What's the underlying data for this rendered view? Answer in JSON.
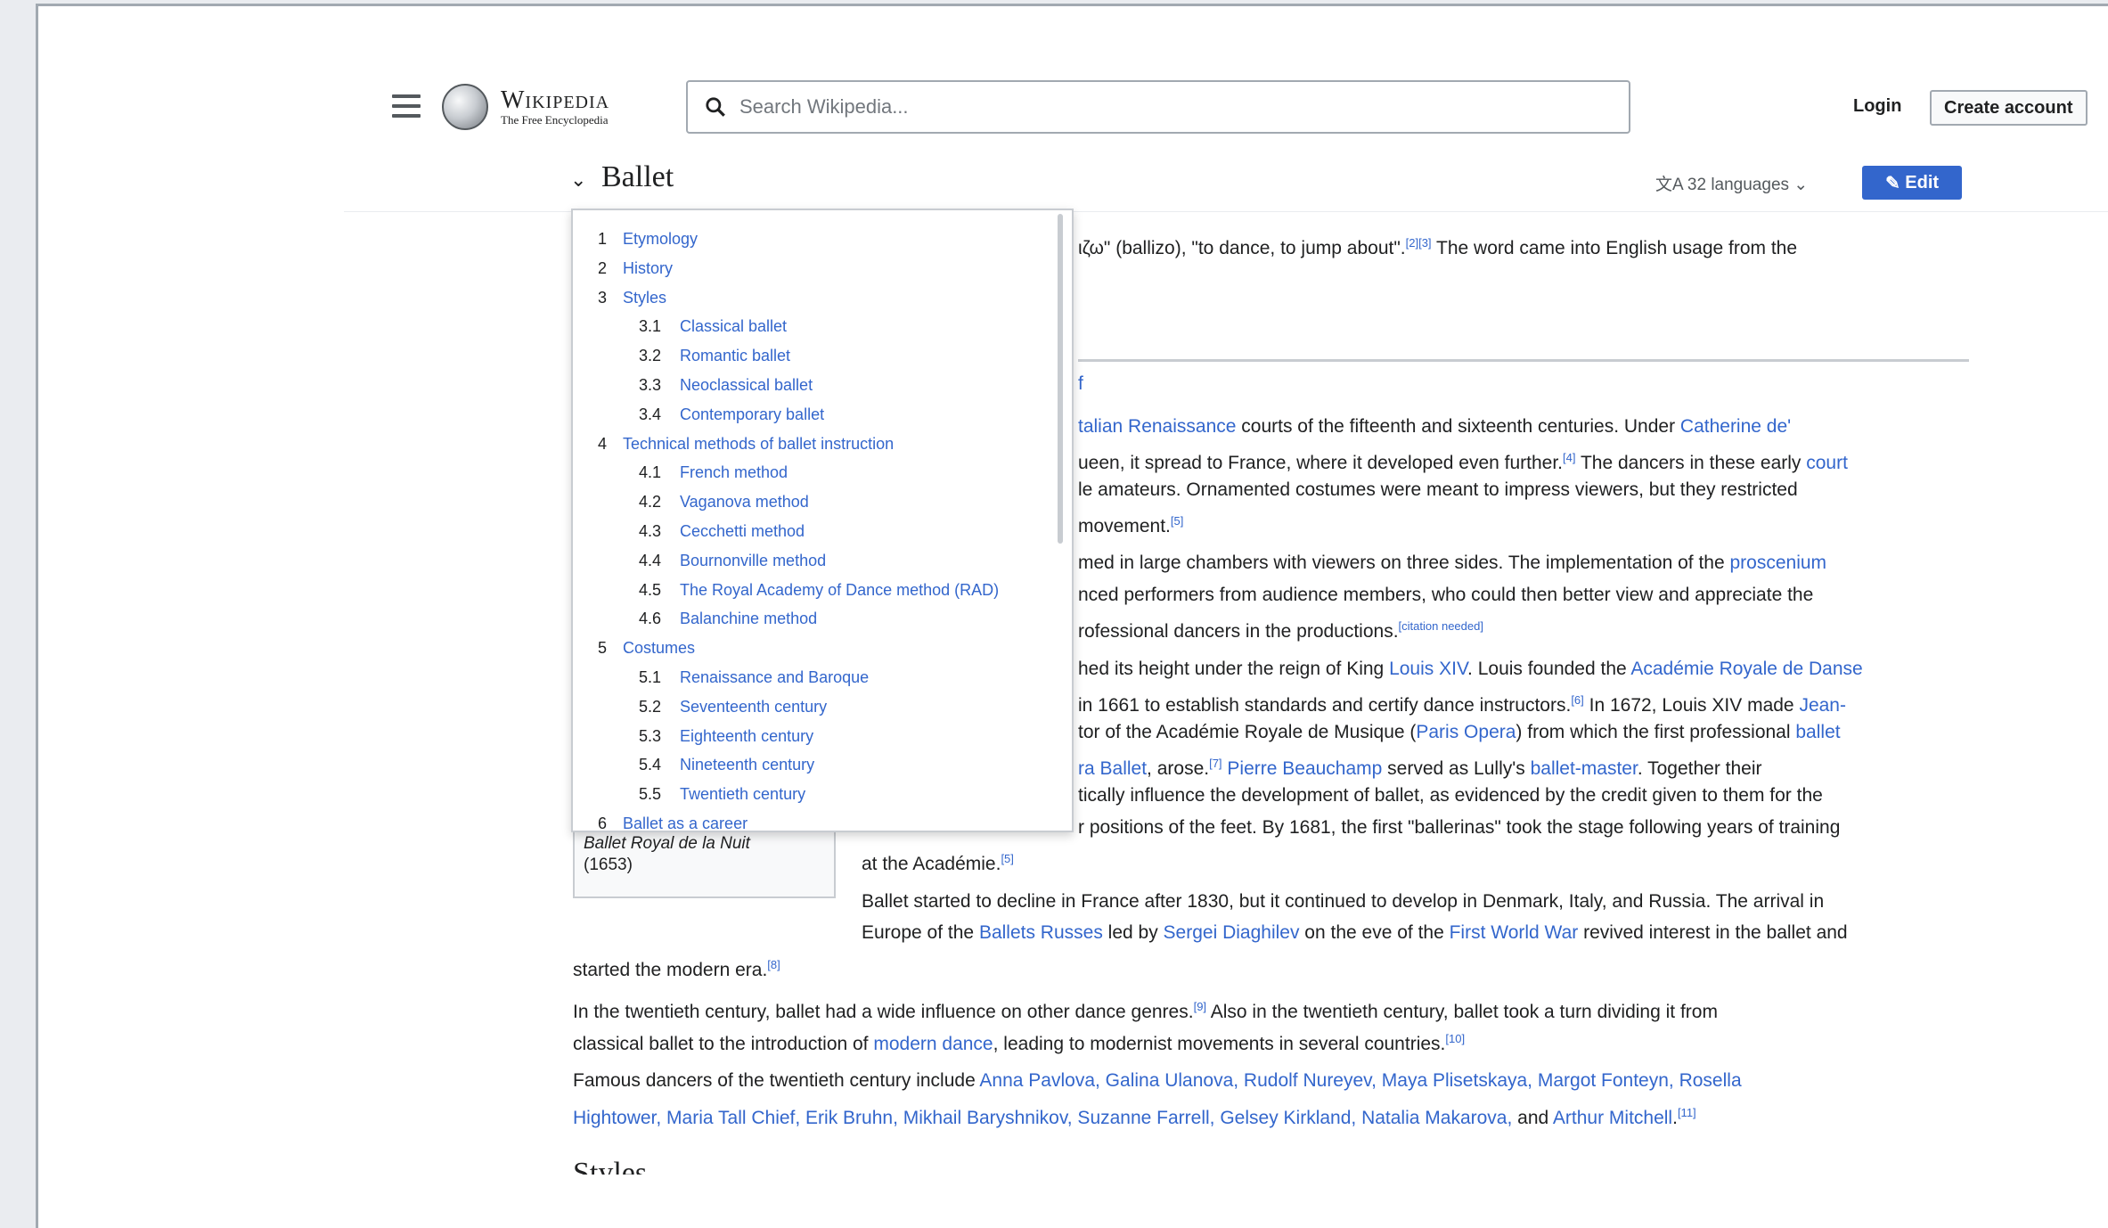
{
  "header": {
    "logo_title": "Wikipedia",
    "logo_tagline": "The Free Encyclopedia",
    "search_placeholder": "Search Wikipedia...",
    "login": "Login",
    "create_account": "Create account"
  },
  "titlebar": {
    "toggle": "⌄",
    "title": "Ballet",
    "languages": "32 languages",
    "edit": "Edit"
  },
  "toc": [
    {
      "num": "1",
      "label": "Etymology",
      "level": 1
    },
    {
      "num": "2",
      "label": "History",
      "level": 1
    },
    {
      "num": "3",
      "label": "Styles",
      "level": 1
    },
    {
      "num": "3.1",
      "label": "Classical ballet",
      "level": 2
    },
    {
      "num": "3.2",
      "label": "Romantic ballet",
      "level": 2
    },
    {
      "num": "3.3",
      "label": "Neoclassical ballet",
      "level": 2
    },
    {
      "num": "3.4",
      "label": "Contemporary ballet",
      "level": 2
    },
    {
      "num": "4",
      "label": "Technical methods of ballet instruction",
      "level": 1
    },
    {
      "num": "4.1",
      "label": "French method",
      "level": 2
    },
    {
      "num": "4.2",
      "label": "Vaganova method",
      "level": 2
    },
    {
      "num": "4.3",
      "label": "Cecchetti method",
      "level": 2
    },
    {
      "num": "4.4",
      "label": "Bournonville method",
      "level": 2
    },
    {
      "num": "4.5",
      "label": "The Royal Academy of Dance method (RAD)",
      "level": 2
    },
    {
      "num": "4.6",
      "label": "Balanchine method",
      "level": 2
    },
    {
      "num": "5",
      "label": "Costumes",
      "level": 1
    },
    {
      "num": "5.1",
      "label": "Renaissance and Baroque",
      "level": 2
    },
    {
      "num": "5.2",
      "label": "Seventeenth century",
      "level": 2
    },
    {
      "num": "5.3",
      "label": "Eighteenth century",
      "level": 2
    },
    {
      "num": "5.4",
      "label": "Nineteenth century",
      "level": 2
    },
    {
      "num": "5.5",
      "label": "Twentieth century",
      "level": 2
    },
    {
      "num": "6",
      "label": "Ballet as a career",
      "level": 1
    }
  ],
  "article": {
    "l1": "ιζω\" (ballizo), \"to dance, to jump about\".",
    "l1_sup": "[2][3]",
    "l1_tail": " The word came into English usage from the",
    "l2_link": "f",
    "l3_link1": "talian Renaissance",
    "l3_mid": " courts of the fifteenth and sixteenth centuries. Under ",
    "l3_link2": "Catherine de'",
    "l4_pre": "ueen, it spread to France, where it developed even further.",
    "l4_sup": "[4]",
    "l4_mid": " The dancers in these early ",
    "l4_link": "court",
    "l5": "le amateurs. Ornamented costumes were meant to impress viewers, but they restricted",
    "l6": " movement.",
    "l6_sup": "[5]",
    "l7_pre": "med in large chambers with viewers on three sides. The implementation of the ",
    "l7_link": "proscenium",
    "l8": "nced performers from audience members, who could then better view and appreciate the",
    "l9": "rofessional dancers in the productions.",
    "l9_sup": "[citation needed]",
    "l10_pre": "hed its height under the reign of King ",
    "l10_link1": "Louis XIV",
    "l10_mid": ". Louis founded the ",
    "l10_link2": "Académie Royale de Danse",
    "l11_pre": " in 1661 to establish standards and certify dance instructors.",
    "l11_sup": "[6]",
    "l11_mid": " In 1672, Louis XIV made ",
    "l11_link": "Jean-",
    "l12_pre": "tor of the Académie Royale de Musique (",
    "l12_link1": "Paris Opera",
    "l12_mid": ") from which the first professional ",
    "l12_link2": "ballet",
    "l13_link1": "ra Ballet",
    "l13_pre": ", arose.",
    "l13_sup": "[7]",
    "l13_link2": "Pierre Beauchamp",
    "l13_mid": " served as Lully's ",
    "l13_link3": "ballet-master",
    "l13_tail": ". Together their",
    "l14": "tically influence the development of ballet, as evidenced by the credit given to them for the",
    "l15": "r positions of the feet. By 1681, the first \"ballerinas\" took the stage following years of training",
    "l16": "at the Académie.",
    "l16_sup": "[5]",
    "caption_title": "Ballet Royal de la Nuit",
    "caption_year": "(1653)",
    "l17": "Ballet started to decline in France after 1830, but it continued to develop in Denmark, Italy, and Russia. The arrival in",
    "l18_pre": "Europe of the ",
    "l18_link1": "Ballets Russes",
    "l18_mid1": " led by ",
    "l18_link2": "Sergei Diaghilev",
    "l18_mid2": " on the eve of the ",
    "l18_link3": "First World War",
    "l18_tail": " revived interest in the ballet and",
    "l19": "started the modern era.",
    "l19_sup": "[8]",
    "l20_pre": "In the twentieth century, ballet had a wide influence on other dance genres.",
    "l20_sup": "[9]",
    "l20_tail": " Also in the twentieth century, ballet took a turn dividing it from",
    "l21_pre": "classical ballet to the introduction of ",
    "l21_link": "modern dance",
    "l21_tail": ", leading to modernist movements in several countries.",
    "l21_sup": "[10]",
    "l22_pre": "Famous dancers of the twentieth century include ",
    "l22_links": "Anna Pavlova, Galina Ulanova, Rudolf Nureyev, Maya Plisetskaya, Margot Fonteyn, Rosella",
    "l23_links": "Hightower, Maria Tall Chief, Erik Bruhn, Mikhail Baryshnikov, Suzanne Farrell, Gelsey Kirkland, Natalia Makarova,",
    "l23_mid": " and ",
    "l23_link": "Arthur Mitchell",
    "l23_tail": ".",
    "l23_sup": "[11]",
    "styles_heading": "Styles"
  },
  "colors": {
    "link": "#3366cc",
    "edit_bg": "#3366cc",
    "text": "#202122"
  }
}
